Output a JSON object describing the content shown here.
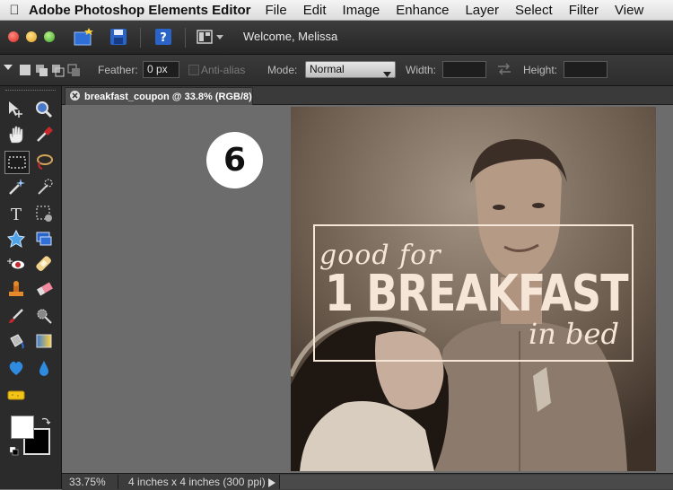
{
  "menubar": {
    "app_name": "Adobe Photoshop Elements Editor",
    "items": [
      "File",
      "Edit",
      "Image",
      "Enhance",
      "Layer",
      "Select",
      "Filter",
      "View"
    ]
  },
  "titlebar": {
    "welcome": "Welcome, Melissa"
  },
  "options": {
    "feather_label": "Feather:",
    "feather_value": "0 px",
    "antialias_label": "Anti-alias",
    "mode_label": "Mode:",
    "mode_value": "Normal",
    "width_label": "Width:",
    "width_value": "",
    "height_label": "Height:",
    "height_value": ""
  },
  "document": {
    "tab_title": "breakfast_coupon @ 33.8% (RGB/8)",
    "step_number": "6",
    "coupon_line1": "good for",
    "coupon_line2": "1 BREAKFAST",
    "coupon_line3": "in bed"
  },
  "status": {
    "zoom": "33.75%",
    "doc_info": "4 inches x 4 inches (300 ppi)"
  },
  "colors": {
    "foreground": "#ffffff",
    "background": "#000000",
    "coupon_text": "#f6e6d8"
  }
}
